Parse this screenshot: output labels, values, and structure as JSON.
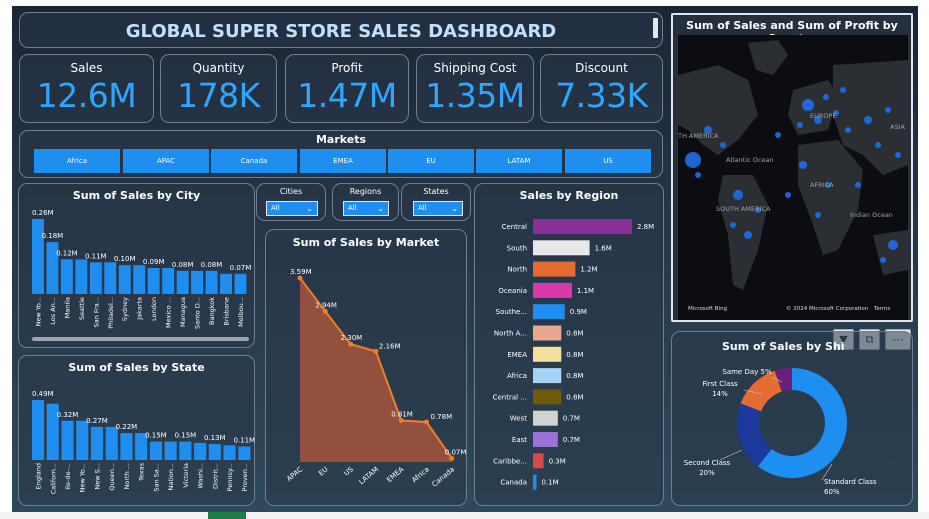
{
  "title": "GLOBAL SUPER STORE SALES DASHBOARD",
  "kpis": [
    {
      "label": "Sales",
      "value": "12.6M"
    },
    {
      "label": "Quantity",
      "value": "178K"
    },
    {
      "label": "Profit",
      "value": "1.47M"
    },
    {
      "label": "Shipping Cost",
      "value": "1.35M"
    },
    {
      "label": "Discount",
      "value": "7.33K"
    }
  ],
  "markets": {
    "title": "Markets",
    "items": [
      "Africa",
      "APAC",
      "Canada",
      "EMEA",
      "EU",
      "LATAM",
      "US"
    ]
  },
  "slicers": [
    {
      "title": "Cities",
      "value": "All"
    },
    {
      "title": "Regions",
      "value": "All"
    },
    {
      "title": "States",
      "value": "All"
    }
  ],
  "map": {
    "title": "Sum of Sales and Sum of Profit by Country",
    "labels": {
      "north_america": "TH AMERICA",
      "europe": "EUROPE",
      "asia": "ASIA",
      "atlantic": "Atlantic Ocean",
      "africa": "AFRICA",
      "south_america": "SOUTH AMERICA",
      "indian": "Indian Ocean"
    },
    "brand": "Microsoft Bing",
    "copyright": "© 2024 Microsoft Corporation",
    "terms": "Terms"
  },
  "icons": {
    "filter": "filter-icon",
    "focus": "focus-mode-icon",
    "more": "more-options-icon"
  },
  "colors": {
    "accent": "#1f8ef1",
    "kpi": "#2fa6ff",
    "market_line": "#f07d2c"
  },
  "chart_data": [
    {
      "id": "city",
      "type": "bar",
      "title": "Sum of Sales by City",
      "categories": [
        "New Yo...",
        "Los An...",
        "Manila",
        "Seattle",
        "San Fra...",
        "Philadel...",
        "Sydney",
        "Jakarta",
        "London",
        "Mexico ...",
        "Managua",
        "Santo D...",
        "Bangkok",
        "Brisbane",
        "Melbou..."
      ],
      "values": [
        0.26,
        0.18,
        0.12,
        0.12,
        0.11,
        0.11,
        0.1,
        0.1,
        0.09,
        0.09,
        0.08,
        0.08,
        0.08,
        0.07,
        0.07
      ],
      "data_labels": [
        "0.26M",
        "0.18M",
        "0.12M",
        "",
        "0.11M",
        "",
        "0.10M",
        "",
        "0.09M",
        "",
        "0.08M",
        "",
        "0.08M",
        "",
        "0.07M"
      ],
      "unit": "M"
    },
    {
      "id": "state",
      "type": "bar",
      "title": "Sum of Sales by State",
      "categories": [
        "England",
        "Californ...",
        "Ile-de-...",
        "New Yo...",
        "New S...",
        "Queen...",
        "North ...",
        "Texas",
        "San Sa...",
        "Nation...",
        "Victoria",
        "Washi...",
        "Distrit...",
        "Pennsy...",
        "Proven..."
      ],
      "values": [
        0.49,
        0.46,
        0.32,
        0.32,
        0.27,
        0.27,
        0.22,
        0.22,
        0.15,
        0.15,
        0.15,
        0.14,
        0.13,
        0.12,
        0.11
      ],
      "data_labels": [
        "0.49M",
        "",
        "0.32M",
        "",
        "0.27M",
        "",
        "0.22M",
        "",
        "0.15M",
        "",
        "0.15M",
        "",
        "0.13M",
        "",
        "0.11M"
      ],
      "unit": "M"
    },
    {
      "id": "market",
      "type": "area",
      "title": "Sum of Sales by Market",
      "categories": [
        "APAC",
        "EU",
        "US",
        "LATAM",
        "EMEA",
        "Africa",
        "Canada"
      ],
      "values": [
        3.59,
        2.94,
        2.3,
        2.16,
        0.81,
        0.78,
        0.07
      ],
      "data_labels": [
        "3.59M",
        "2.94M",
        "2.30M",
        "2.16M",
        "0.81M",
        "0.78M",
        "0.07M"
      ],
      "unit": "M"
    },
    {
      "id": "region",
      "type": "bar",
      "orientation": "horizontal",
      "title": "Sales by Region",
      "categories": [
        "Central",
        "South",
        "North",
        "Oceania",
        "Southe...",
        "North A...",
        "EMEA",
        "Africa",
        "Central ...",
        "West",
        "East",
        "Caribbe...",
        "Canada"
      ],
      "values": [
        2.8,
        1.6,
        1.2,
        1.1,
        0.9,
        0.8,
        0.8,
        0.8,
        0.8,
        0.7,
        0.7,
        0.3,
        0.1
      ],
      "data_labels": [
        "2.8M",
        "1.6M",
        "1.2M",
        "1.1M",
        "0.9M",
        "0.8M",
        "0.8M",
        "0.8M",
        "0.8M",
        "0.7M",
        "0.7M",
        "0.3M",
        "0.1M"
      ],
      "colors": [
        "#8b2f97",
        "#e8e8e8",
        "#e46b32",
        "#d93aa8",
        "#1f8ef1",
        "#eba68e",
        "#f2e09a",
        "#a7d3f7",
        "#6e5a0c",
        "#d2d2d2",
        "#9a71d6",
        "#d34b4b",
        "#1f8ef1"
      ],
      "unit": "M"
    },
    {
      "id": "ship",
      "type": "pie",
      "title": "Sum of Sales by Shi",
      "categories": [
        "Standard Class",
        "Second Class",
        "First Class",
        "Same Day"
      ],
      "values": [
        60,
        20,
        14,
        5
      ],
      "data_labels": [
        "Standard Class 60%",
        "Second Class 20%",
        "First Class 14%",
        "Same Day 5%"
      ],
      "colors": [
        "#1f8ef1",
        "#1c3a9e",
        "#e46b32",
        "#6b1f7d"
      ]
    }
  ]
}
